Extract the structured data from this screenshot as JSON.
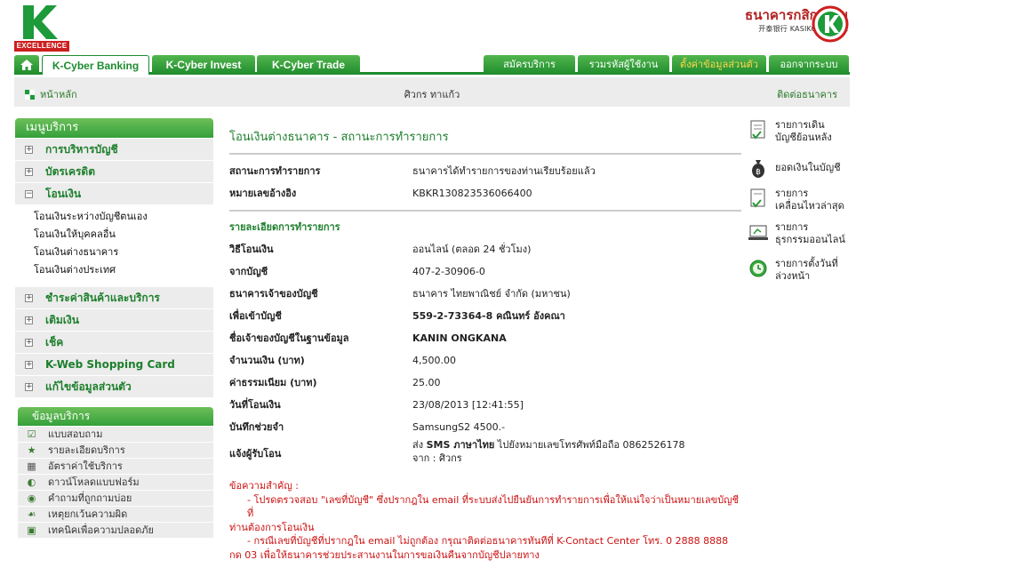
{
  "brand": {
    "k_excellence_band": "EXCELLENCE",
    "bank_name_th": "ธนาคารกสิกรไทย",
    "bank_name_en": "开泰银行 KASIKORNBANK",
    "accent_green": "#1d8c2f",
    "accent_red": "#cc1f1f"
  },
  "tabs": {
    "home_icon": "home-icon",
    "k_cyber_banking": "K-Cyber Banking",
    "k_cyber_invest": "K-Cyber Invest",
    "k_cyber_trade": "K-Cyber Trade",
    "subscribe": "สมัครบริการ",
    "combine_user": "รวมรหัสผู้ใช้งาน",
    "personal_settings": "ตั้งค่าข้อมูลส่วนตัว",
    "logout": "ออกจากระบบ"
  },
  "subbar": {
    "home": "หน้าหลัก",
    "user_name": "ศิวกร ทาแก้ว",
    "contact": "ติดต่อธนาคาร"
  },
  "menu": {
    "title": "เมนูบริการ",
    "items": [
      {
        "label": "การบริหารบัญชี",
        "state": "+"
      },
      {
        "label": "บัตรเครดิต",
        "state": "+"
      },
      {
        "label": "โอนเงิน",
        "state": "−"
      }
    ],
    "transfer_sub": [
      "โอนเงินระหว่างบัญชีตนเอง",
      "โอนเงินให้บุคคลอื่น",
      "โอนเงินต่างธนาคาร",
      "โอนเงินต่างประเทศ"
    ],
    "items2": [
      {
        "label": "ชำระค่าสินค้าและบริการ",
        "state": "+"
      },
      {
        "label": "เติมเงิน",
        "state": "+"
      },
      {
        "label": "เช็ค",
        "state": "+"
      },
      {
        "label": "K-Web Shopping Card",
        "state": "+"
      },
      {
        "label": "แก้ไขข้อมูลส่วนตัว",
        "state": "+"
      }
    ]
  },
  "info_menu": {
    "title": "ข้อมูลบริการ",
    "items": [
      {
        "label": "แบบสอบถาม",
        "icon": "checkbox-icon"
      },
      {
        "label": "รายละเอียดบริการ",
        "icon": "star-icon"
      },
      {
        "label": "อัตราค่าใช้บริการ",
        "icon": "calculator-icon"
      },
      {
        "label": "ดาวน์โหลดแบบฟอร์ม",
        "icon": "download-icon"
      },
      {
        "label": "คำถามที่ถูกถามบ่อย",
        "icon": "faq-icon"
      },
      {
        "label": "เหตุยกเว้นความผิด",
        "icon": "hand-icon"
      },
      {
        "label": "เทคนิคเพื่อความปลอดภัย",
        "icon": "lock-icon"
      }
    ]
  },
  "main": {
    "title": "โอนเงินต่างธนาคาร - สถานะการทำรายการ",
    "status_label": "สถานะการทำรายการ",
    "status_value": "ธนาคารได้ทำรายการของท่านเรียบร้อยแล้ว",
    "ref_label": "หมายเลขอ้างอิง",
    "ref_value": "KBKR130823536066400",
    "detail_title": "รายละเอียดการทำรายการ",
    "method_label": "วิธีโอนเงิน",
    "method_value": "ออนไลน์ (ตลอด 24 ชั่วโมง)",
    "from_label": "จากบัญชี",
    "from_value": "407-2-30906-0",
    "bank_label": "ธนาคารเจ้าของบัญชี",
    "bank_value": "ธนาคาร ไทยพาณิชย์ จำกัด (มหาชน)",
    "to_label": "เพื่อเข้าบัญชี",
    "to_value": "559-2-73364-8 คณินทร์ อังคณา",
    "owner_label": "ชื่อเจ้าของบัญชีในฐานข้อมูล",
    "owner_value": "KANIN ONGKANA",
    "amount_label": "จำนวนเงิน (บาท)",
    "amount_value": "4,500.00",
    "fee_label": "ค่าธรรมเนียม (บาท)",
    "fee_value": "25.00",
    "date_label": "วันที่โอนเงิน",
    "date_value": "23/08/2013 [12:41:55]",
    "memo_label": "บันทึกช่วยจำ",
    "memo_value": "SamsungS2 4500.-",
    "notify_label": "แจ้งผู้รับโอน",
    "notify_prefix": "ส่ง",
    "notify_bold": "SMS ภาษาไทย",
    "notify_suffix": "ไปยังหมายเลขโทรศัพท์มือถือ 0862526178",
    "notify_from": "จาก : ศิวกร",
    "notes_title": "ข้อความสำคัญ :",
    "note1a": "- โปรดตรวจสอบ \"เลขที่บัญชี\" ซึ่งปรากฎใน email ที่ระบบส่งไปยืนยันการทำรายการเพื่อให้แน่ใจว่าเป็นหมายเลขบัญชีที่",
    "note1b": "ท่านต้องการโอนเงิน",
    "note2a": "- กรณีเลขที่บัญชีที่ปรากฎใน email ไม่ถูกต้อง กรุณาติดต่อธนาคารทันทีที่ K-Contact Center โทร. 0 2888 8888",
    "note2b": "กด 03 เพื่อให้ธนาคารช่วยประสานงานในการขอเงินคืนจากบัญชีปลายทาง"
  },
  "quick_links": [
    {
      "line1": "รายการเดิน",
      "line2": "บัญชีย้อนหลัง",
      "icon": "statement-icon"
    },
    {
      "line1": "ยอดเงินในบัญชี",
      "line2": "",
      "icon": "money-bag-icon"
    },
    {
      "line1": "รายการ",
      "line2": "เคลื่อนไหวล่าสุด",
      "icon": "recent-icon"
    },
    {
      "line1": "รายการ",
      "line2": "ธุรกรรมออนไลน์",
      "icon": "online-icon"
    },
    {
      "line1": "รายการตั้งวันที่",
      "line2": "ล่วงหน้า",
      "icon": "clock-icon"
    }
  ]
}
